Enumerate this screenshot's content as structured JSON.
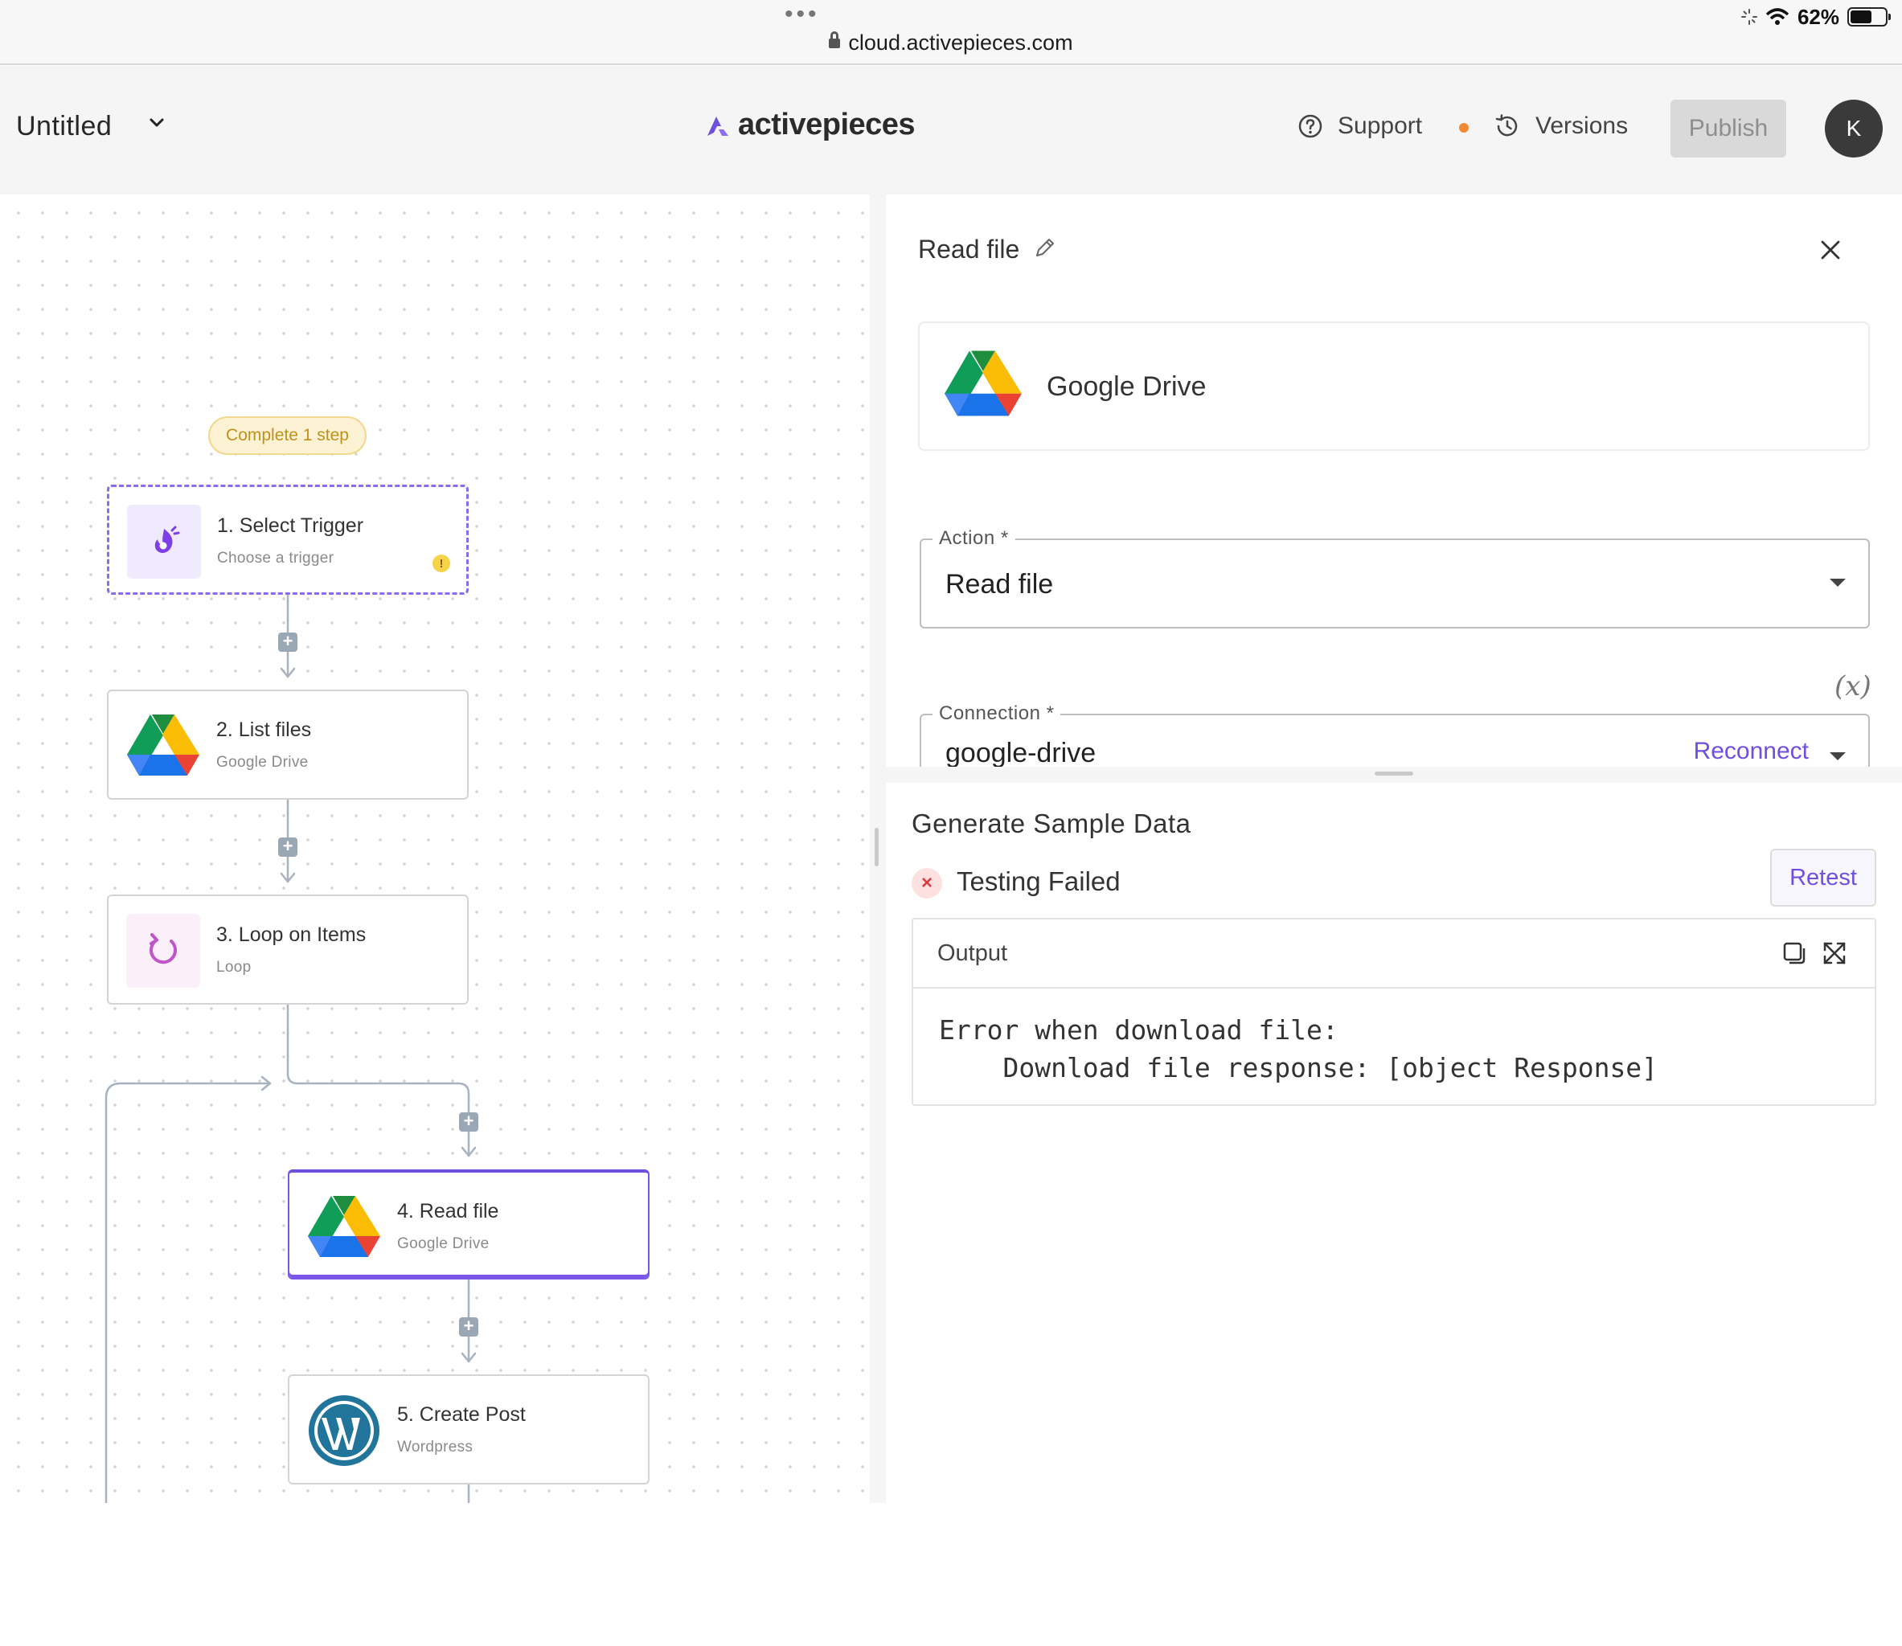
{
  "browser": {
    "url": "cloud.activepieces.com",
    "battery_text": "62%",
    "battery_level": 0.62
  },
  "header": {
    "flow_title": "Untitled",
    "brand": "activepieces",
    "support_label": "Support",
    "versions_label": "Versions",
    "publish_label": "Publish",
    "avatar_initial": "K"
  },
  "canvas": {
    "badge": "Complete 1 step",
    "steps": [
      {
        "title": "1. Select Trigger",
        "subtitle": "Choose a trigger",
        "icon": "trigger-icon"
      },
      {
        "title": "2. List files",
        "subtitle": "Google Drive",
        "icon": "google-drive-icon"
      },
      {
        "title": "3. Loop on Items",
        "subtitle": "Loop",
        "icon": "loop-icon"
      },
      {
        "title": "4. Read file",
        "subtitle": "Google Drive",
        "icon": "google-drive-icon"
      },
      {
        "title": "5. Create Post",
        "subtitle": "Wordpress",
        "icon": "wordpress-icon"
      }
    ],
    "warning_mark": "!",
    "plus_mark": "+"
  },
  "panel": {
    "title": "Read file",
    "piece_name": "Google Drive",
    "action_label": "Action *",
    "action_value": "Read file",
    "fx_label": "(x)",
    "connection_label": "Connection *",
    "connection_value": "google-drive",
    "reconnect_label": "Reconnect",
    "sample_title": "Generate Sample Data",
    "fail_mark": "×",
    "test_status": "Testing Failed",
    "retest_label": "Retest",
    "output_label": "Output",
    "output_error": "Error when download file:\n    Download file response: [object Response]"
  },
  "colors": {
    "accent": "#6e4fe0",
    "error": "#e0393e",
    "warning_badge": "#fdf3d4",
    "status_dot": "#f28a34"
  }
}
